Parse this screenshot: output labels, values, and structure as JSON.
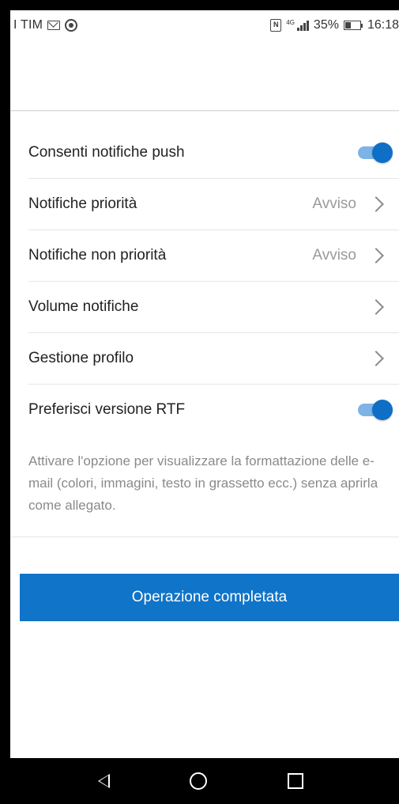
{
  "status_bar": {
    "carrier": "I TIM",
    "battery": "35%",
    "time": "16:18",
    "network": "4G"
  },
  "settings": {
    "push_notifications": {
      "label": "Consenti notifiche push",
      "enabled": true
    },
    "priority_notifications": {
      "label": "Notifiche priorità",
      "value": "Avviso"
    },
    "non_priority_notifications": {
      "label": "Notifiche non priorità",
      "value": "Avviso"
    },
    "notification_volume": {
      "label": "Volume notifiche"
    },
    "profile_management": {
      "label": "Gestione profilo"
    },
    "prefer_rtf": {
      "label": "Preferisci versione RTF",
      "enabled": true
    }
  },
  "rtf_description": "Attivare l'opzione per visualizzare la formattazione delle e-mail (colori, immagini, testo in grassetto ecc.) senza aprirla come allegato.",
  "done_button": {
    "label": "Operazione completata"
  },
  "colors": {
    "accent": "#1074c8",
    "toggle_track": "#7db3e6"
  }
}
